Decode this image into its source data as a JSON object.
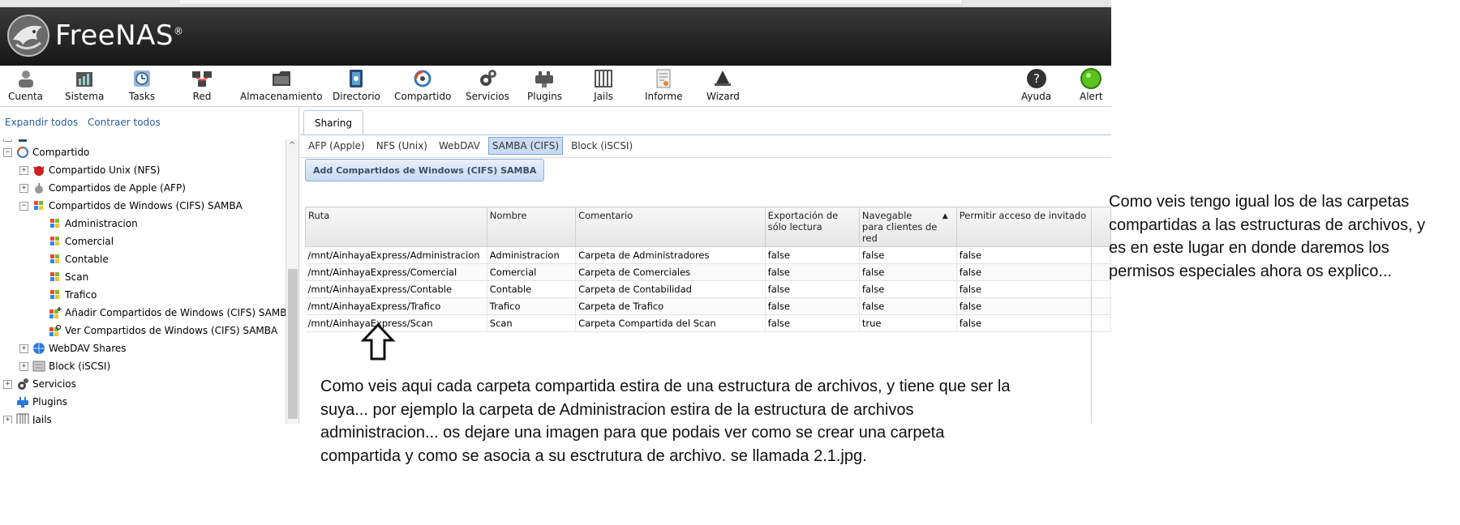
{
  "app": {
    "name": "FreeNAS",
    "trademark": "®"
  },
  "toolbar": [
    {
      "label": "Cuenta",
      "icon": "account-icon"
    },
    {
      "label": "Sistema",
      "icon": "system-icon"
    },
    {
      "label": "Tasks",
      "icon": "tasks-icon"
    },
    {
      "label": "Red",
      "icon": "network-icon"
    },
    {
      "label": "Almacenamiento",
      "icon": "storage-icon"
    },
    {
      "label": "Directorio",
      "icon": "directory-icon"
    },
    {
      "label": "Compartido",
      "icon": "sharing-icon"
    },
    {
      "label": "Servicios",
      "icon": "services-icon"
    },
    {
      "label": "Plugins",
      "icon": "plugins-icon"
    },
    {
      "label": "Jails",
      "icon": "jails-icon"
    },
    {
      "label": "Informe",
      "icon": "report-icon"
    },
    {
      "label": "Wizard",
      "icon": "wizard-icon"
    }
  ],
  "toolbar_right": [
    {
      "label": "Ayuda",
      "icon": "help-icon"
    },
    {
      "label": "Alert",
      "icon": "alert-icon",
      "color": "#5cc21e"
    }
  ],
  "sidebar": {
    "expand_all": "Expandir todos",
    "collapse_all": "Contraer todos",
    "tree": {
      "compartido": "Compartido",
      "unix": "Compartido Unix (NFS)",
      "apple": "Compartidos de Apple (AFP)",
      "windows": "Compartidos de Windows (CIFS) SAMBA",
      "shares": [
        "Administracion",
        "Comercial",
        "Contable",
        "Scan",
        "Trafico"
      ],
      "add": "Añadir Compartidos de Windows (CIFS) SAMBA",
      "view": "Ver Compartidos de Windows (CIFS) SAMBA",
      "webdav": "WebDAV Shares",
      "block": "Block (iSCSI)",
      "servicios": "Servicios",
      "plugins": "Plugins",
      "jails": "Jails"
    }
  },
  "main": {
    "tab": "Sharing",
    "subtabs": [
      "AFP (Apple)",
      "NFS (Unix)",
      "WebDAV",
      "SAMBA (CIFS)",
      "Block (iSCSI)"
    ],
    "active_subtab": "SAMBA (CIFS)",
    "add_button": "Add Compartidos de Windows (CIFS) SAMBA",
    "table": {
      "headers": {
        "ruta": "Ruta",
        "nombre": "Nombre",
        "comentario": "Comentario",
        "export_ro_1": "Exportación de",
        "export_ro_2": "sólo lectura",
        "nav_1": "Navegable",
        "nav_2": "para clientes de red",
        "guest": "Permitir acceso de invitado"
      },
      "rows": [
        [
          "/mnt/AinhayaExpress/Administracion",
          "Administracion",
          "Carpeta de Administradores",
          "false",
          "false",
          "false"
        ],
        [
          "/mnt/AinhayaExpress/Comercial",
          "Comercial",
          "Carpeta de Comerciales",
          "false",
          "false",
          "false"
        ],
        [
          "/mnt/AinhayaExpress/Contable",
          "Contable",
          "Carpeta de Contabilidad",
          "false",
          "false",
          "false"
        ],
        [
          "/mnt/AinhayaExpress/Trafico",
          "Trafico",
          "Carpeta de Trafico",
          "false",
          "false",
          "false"
        ],
        [
          "/mnt/AinhayaExpress/Scan",
          "Scan",
          "Carpeta Compartida del Scan",
          "false",
          "true",
          "false"
        ]
      ]
    }
  },
  "annotations": {
    "note_table": "Como veis aqui cada carpeta compartida estira de una estructura de archivos, y tiene que ser la suya... por ejemplo la carpeta de Administracion estira de la estructura de archivos administracion... os dejare una imagen para que podais ver como se crear una carpeta compartida y como se asocia a su esctrutura de archivo. se llamada 2.1.jpg.",
    "note_side": "Como veis tengo igual los de las carpetas compartidas a las estructuras de archivos, y es en este lugar en donde daremos los permisos especiales ahora os explico..."
  }
}
